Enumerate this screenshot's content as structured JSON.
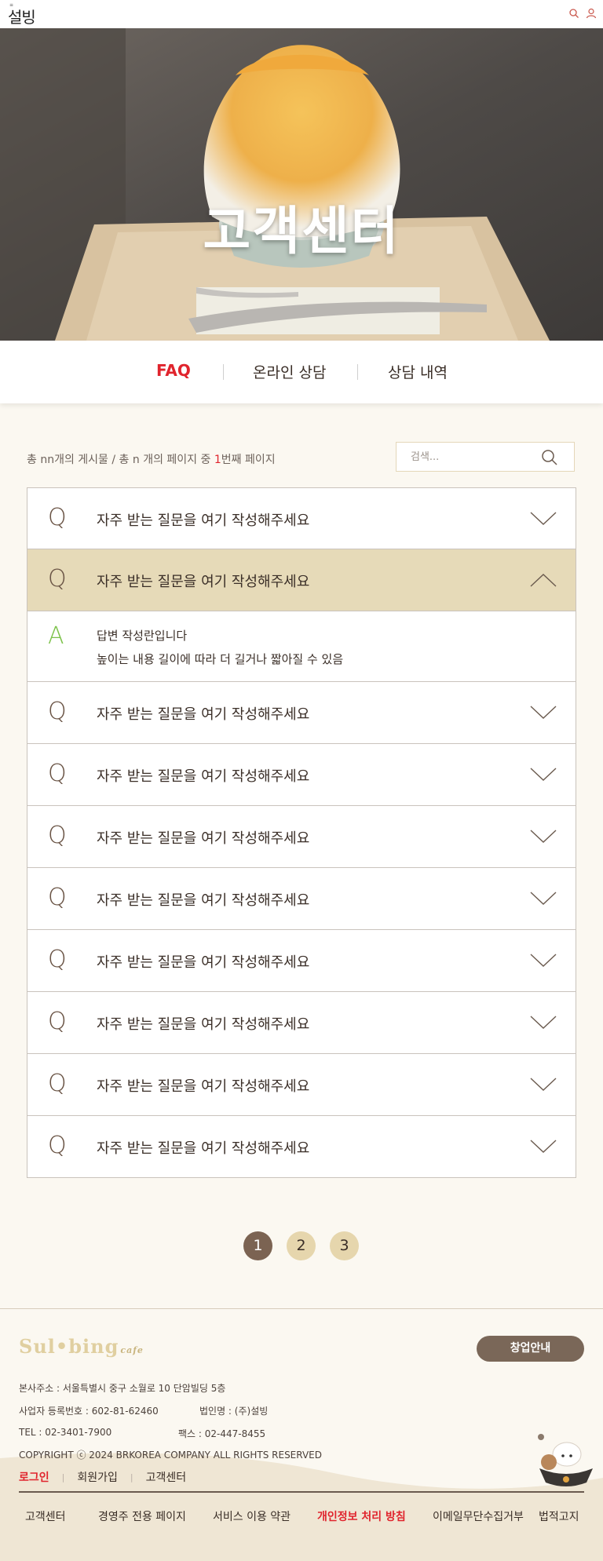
{
  "header": {
    "logo_text": "설빙",
    "search_icon": "search-icon",
    "user_icon": "user-icon"
  },
  "hero": {
    "title": "고객센터"
  },
  "tabs": [
    {
      "label": "FAQ",
      "active": true
    },
    {
      "label": "온라인 상담",
      "active": false
    },
    {
      "label": "상담 내역",
      "active": false
    }
  ],
  "listing": {
    "info_prefix": "총 nn개의 게시물 / 총 n 개의 페이지 중 ",
    "info_current": "1",
    "info_suffix": "번째 페이지",
    "search_placeholder": "검색..."
  },
  "faq": {
    "q_letter": "Q",
    "a_letter": "A",
    "items": [
      {
        "question": "자주 받는 질문을 여기 작성해주세요",
        "open": false
      },
      {
        "question": "자주 받는 질문을 여기 작성해주세요",
        "open": true,
        "answer_line1": "답변 작성란입니다",
        "answer_line2": "높이는 내용 길이에 따라 더 길거나 짧아질 수 있음"
      },
      {
        "question": "자주 받는 질문을 여기 작성해주세요",
        "open": false
      },
      {
        "question": "자주 받는 질문을 여기 작성해주세요",
        "open": false
      },
      {
        "question": "자주 받는 질문을 여기 작성해주세요",
        "open": false
      },
      {
        "question": "자주 받는 질문을 여기 작성해주세요",
        "open": false
      },
      {
        "question": "자주 받는 질문을 여기 작성해주세요",
        "open": false
      },
      {
        "question": "자주 받는 질문을 여기 작성해주세요",
        "open": false
      },
      {
        "question": "자주 받는 질문을 여기 작성해주세요",
        "open": false
      },
      {
        "question": "자주 받는 질문을 여기 작성해주세요",
        "open": false
      }
    ]
  },
  "pagination": {
    "pages": [
      "1",
      "2",
      "3"
    ],
    "current": "1"
  },
  "footer": {
    "logo_main": "Sul•bing",
    "logo_cafe": "cafe",
    "startup_button": "창업안내",
    "address": "본사주소 : 서울특별시 중구 소월로 10 단암빌딩 5층",
    "biz_number": "사업자 등록번호 : 602-81-62460",
    "corp_name": "법인명 : (주)설빙",
    "tel": "TEL : 02-3401-7900",
    "fax": "팩스 : 02-447-8455",
    "copyright": "COPYRIGHT ⓒ 2024 BRKOREA COMPANY ALL RIGHTS RESERVED",
    "links": {
      "login": "로그인",
      "signup": "회원가입",
      "support": "고객센터"
    },
    "bottom_links": [
      {
        "label": "고객센터",
        "highlight": false
      },
      {
        "label": "경영주 전용 페이지",
        "highlight": false
      },
      {
        "label": "서비스 이용 약관",
        "highlight": false
      },
      {
        "label": "개인정보 처리 방침",
        "highlight": true
      },
      {
        "label": "이메일무단수집거부",
        "highlight": false
      },
      {
        "label": "법적고지",
        "highlight": false
      }
    ],
    "mascot_icon": "bingsu-mascot-icon"
  },
  "colors": {
    "accent_red": "#e0242d",
    "open_row_bg": "#e6dab8",
    "page_bg": "#fbf8f1",
    "button_brown": "#7a6758",
    "answer_green": "#7cc24a"
  }
}
